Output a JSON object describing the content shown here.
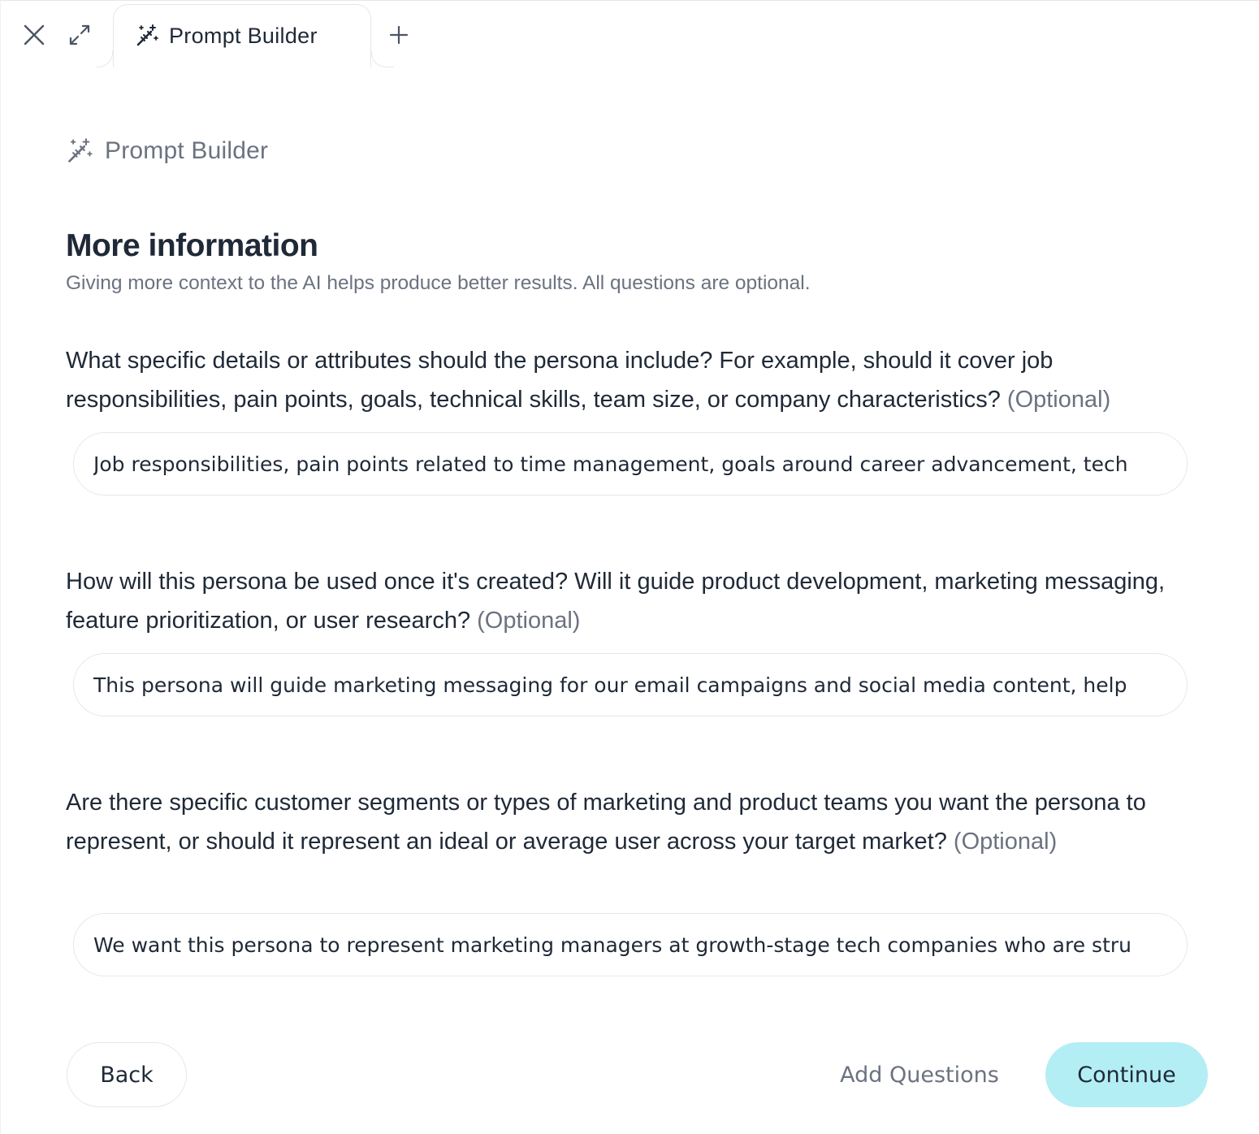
{
  "tabbar": {
    "close_icon": "close-icon",
    "expand_icon": "expand-icon",
    "tab_label": "Prompt Builder",
    "tab_icon": "magic-wand-icon",
    "new_tab_icon": "plus-icon"
  },
  "header": {
    "breadcrumb_label": "Prompt Builder",
    "breadcrumb_icon": "magic-wand-icon",
    "title": "More information",
    "subtitle": "Giving more context to the AI helps produce better results. All questions are optional."
  },
  "questions": [
    {
      "text": "What specific details or attributes should the persona include? For example, should it cover job responsibilities, pain points, goals, technical skills, team size, or company characteristics?",
      "optional_label": "(Optional)",
      "answer": "Job responsibilities, pain points related to time management, goals around career advancement, tech"
    },
    {
      "text": "How will this persona be used once it's created? Will it guide product development, marketing messaging, feature prioritization, or user research?",
      "optional_label": "(Optional)",
      "answer": "This persona will guide marketing messaging for our email campaigns and social media content, help"
    },
    {
      "text": "Are there specific customer segments or types of marketing and product teams you want the persona to represent, or should it represent an ideal or average user across your target market?",
      "optional_label": "(Optional)",
      "answer": "We want this persona to represent marketing managers at growth-stage tech companies who are stru"
    }
  ],
  "footer": {
    "back_label": "Back",
    "add_questions_label": "Add Questions",
    "continue_label": "Continue",
    "continue_color": "#b3eef4"
  }
}
